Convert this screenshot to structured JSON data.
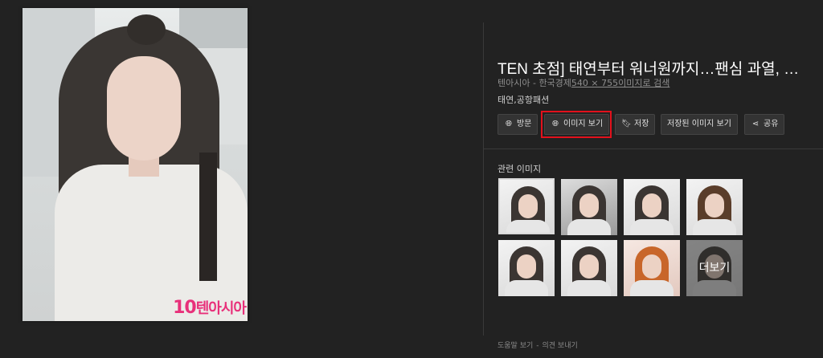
{
  "main_image": {
    "watermark_prefix": "10",
    "watermark_text": "텐아시아"
  },
  "detail": {
    "title": "TEN 초점] 태연부터 워너원까지…팬심 과열, …",
    "source_site": "텐아시아 - 한국경제",
    "dimensions": "540 × 755",
    "search_link": "이미지로 검색",
    "tags": "태연,공항패션"
  },
  "buttons": {
    "visit": "방문",
    "view_image": "이미지 보기",
    "save": "저장",
    "saved_images": "저장된 이미지 보기",
    "share": "공유"
  },
  "related": {
    "title": "관련 이미지",
    "more_label": "더보기"
  },
  "footer": {
    "help": "도움말 보기",
    "separator": "-",
    "feedback": "의견 보내기"
  },
  "colors": {
    "background": "#222222",
    "highlight": "#e3111c",
    "watermark": "#e8307a"
  }
}
